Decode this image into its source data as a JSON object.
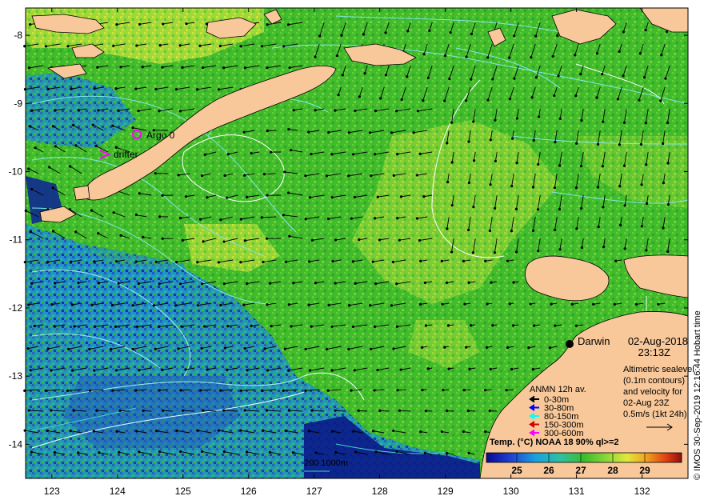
{
  "map": {
    "x_ticks": [
      "123",
      "124",
      "125",
      "126",
      "127",
      "128",
      "129",
      "130",
      "131",
      "132"
    ],
    "y_ticks": [
      "-8",
      "-9",
      "-10",
      "-11",
      "-12",
      "-13",
      "-14"
    ],
    "lon_range": [
      122.6,
      132.7
    ],
    "lat_range": [
      -14.5,
      -7.6
    ]
  },
  "markers": {
    "argo_label": "Argo 0",
    "drifter_label": "drifter",
    "argo_color": "#ff00ff",
    "drifter_color": "#ff00ff"
  },
  "city": {
    "name": "Darwin"
  },
  "title": {
    "date": "02-Aug-2018",
    "time": "23:13Z"
  },
  "altimetry": {
    "line1": "Altimetric sealevel",
    "line2": "(0.1m contours)",
    "line3": "and velocity for",
    "line4": "02-Aug 23Z",
    "line5": "0.5m/s (1kt 24h)"
  },
  "legend": {
    "title": "ANMN 12h av.",
    "items": [
      {
        "label": "0-30m",
        "color": "#000000"
      },
      {
        "label": "30-80m",
        "color": "#0000ff"
      },
      {
        "label": "80-150m",
        "color": "#00ffff"
      },
      {
        "label": "150-300m",
        "color": "#cc0000"
      },
      {
        "label": "300-600m",
        "color": "#ff00ff"
      }
    ]
  },
  "colorbar": {
    "title": "Temp. (°C) NOAA 18 90% ql>=2",
    "ticks": [
      "25",
      "26",
      "27",
      "28",
      "29"
    ]
  },
  "depth_label": "200  1000m",
  "credit": "© IMOS 30-Sep-2019 12:16:44 Hobart time"
}
